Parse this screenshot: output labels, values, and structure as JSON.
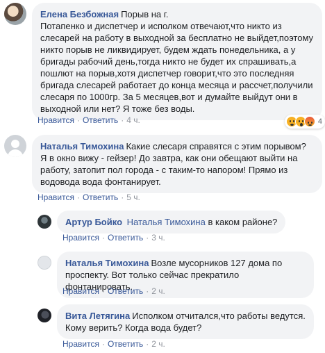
{
  "comments": [
    {
      "author": "Елена Безбожная",
      "text_first": "Порыв на г.",
      "text_rest": "Потапенко и диспетчер и исполком отвечают,что никто из\nслесарей на работу в выходной за бесплатно не выйдет,поэтому\nникто порыв не ликвидирует, будем ждать понедельника, а у\nбригады рабочий день,тогда никто не будет их спрашивать,а\nпошлют на порыв,хотя диспетчер говорит,что это последняя\nбригада слесарей работает до конца месяца и рассчет,получили\nслесаря по 1000гр. За 5 месяцев,вот и думайте выйдут они в\nвыходной или нет? Я тоже без воды.",
      "reaction_count": "4",
      "like": "Нравится",
      "reply": "Ответить",
      "time": "4 ч.",
      "avatar_icon": "user-photo"
    },
    {
      "author": "Наталья Тимохина",
      "text_first": "Какие слесаря справятся с этим порывом?",
      "text_rest": "Я в окно вижу - гейзер! До завтра, как они обещают выйти на\nработу, затопит пол города - с таким-то напором! Прямо из\nводовода вода фонтанирует.",
      "like": "Нравится",
      "reply": "Ответить",
      "time": "5 ч.",
      "avatar_icon": "default-user-silhouette"
    }
  ],
  "replies": [
    {
      "author": "Артур Бойко",
      "mention": "Наталья Тимохина",
      "text": "в каком районе?",
      "like": "Нравится",
      "reply": "Ответить",
      "time": "3 ч."
    },
    {
      "author": "Наталья Тимохина",
      "text_first": "Возле мусорников 127 дома по",
      "text_rest": "проспекту. Вот только сейчас прекратило фонтанировать.",
      "like": "Нравится",
      "reply": "Ответить",
      "time": "2 ч."
    },
    {
      "author": "Вита Летягина",
      "text_first": "Исполком отчитался,что работы ведутся.",
      "text_rest": "Кому верить? Когда вода будет?",
      "like": "Нравится",
      "reply": "Ответить",
      "time": "2 ч."
    }
  ],
  "reactions": [
    "sad-reaction",
    "wow-reaction",
    "angry-reaction"
  ],
  "colors": {
    "link": "#385898",
    "bubble": "#f2f3f5",
    "meta": "#90949c"
  }
}
